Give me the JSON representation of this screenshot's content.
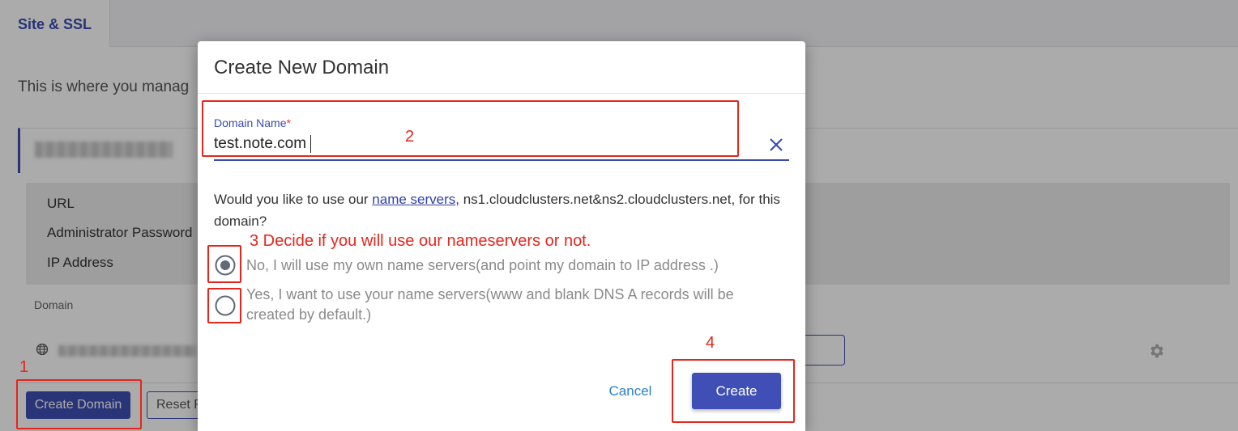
{
  "background": {
    "tab_label": "Site & SSL",
    "intro_text": "This is where you manag",
    "details": [
      "URL",
      "Administrator Password",
      "IP Address"
    ],
    "domain_header": "Domain",
    "create_domain_label": "Create Domain",
    "reset_label": "Reset P"
  },
  "modal": {
    "title": "Create New Domain",
    "field_label": "Domain Name",
    "required_mark": "*",
    "field_value": "test.note.com",
    "question_pre": "Would you like to use our ",
    "question_link": "name servers",
    "question_post": ", ns1.cloudclusters.net&ns2.cloudclusters.net, for this domain?",
    "option_no": "No, I will use my own name servers(and point my domain to IP address .)",
    "option_yes": "Yes, I want to use your name servers(www and blank DNS A records will be created by default.)",
    "selected_option": "no",
    "cancel_label": "Cancel",
    "create_label": "Create"
  },
  "annotations": {
    "step1": "1",
    "step2": "2",
    "step3": "3 Decide if you will use our nameservers or not.",
    "step4": "4"
  },
  "colors": {
    "primary": "#3f4fb5",
    "annotation": "#e4261c",
    "link": "#2b82c8"
  }
}
